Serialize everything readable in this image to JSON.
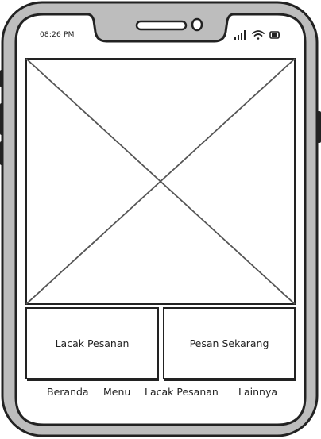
{
  "status_bar": {
    "time": "08:26 PM",
    "icons": [
      "signal-icon",
      "wifi-icon",
      "battery-icon"
    ]
  },
  "hero": {
    "icon": "image-placeholder-icon"
  },
  "actions": {
    "track_order": "Lacak Pesanan",
    "order_now": "Pesan Sekarang"
  },
  "bottom_nav": {
    "items": [
      {
        "label": "Beranda"
      },
      {
        "label": "Menu"
      },
      {
        "label": "Lacak Pesanan"
      },
      {
        "label": "Lainnya"
      }
    ]
  },
  "colors": {
    "frame": "#bdbdbd",
    "stroke": "#222222",
    "screen": "#ffffff"
  }
}
